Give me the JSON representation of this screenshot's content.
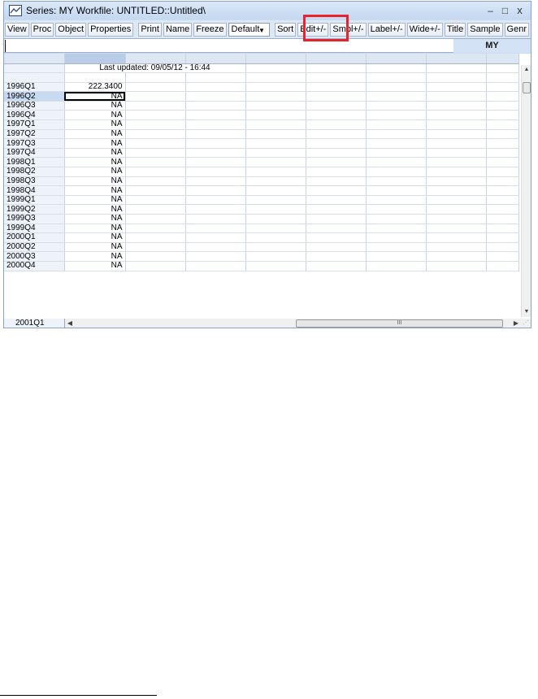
{
  "window": {
    "title": "Series: MY   Workfile: UNTITLED::Untitled\\",
    "minimize": "–",
    "maximize": "□",
    "close": "x"
  },
  "toolbar": {
    "view": "View",
    "proc": "Proc",
    "object": "Object",
    "properties": "Properties",
    "print": "Print",
    "name": "Name",
    "freeze": "Freeze",
    "display_mode": "Default",
    "sort": "Sort",
    "edit": "Edit+/-",
    "smpl": "Smpl+/-",
    "label": "Label+/-",
    "wide": "Wide+/-",
    "title": "Title",
    "sample": "Sample",
    "genr": "Genr"
  },
  "edit_bar": {
    "value": "",
    "series_name": "MY"
  },
  "grid": {
    "last_updated": "Last updated: 09/05/12 - 16:44",
    "rows": [
      {
        "label": "1996Q1",
        "value": "222.3400"
      },
      {
        "label": "1996Q2",
        "value": "NA"
      },
      {
        "label": "1996Q3",
        "value": "NA"
      },
      {
        "label": "1996Q4",
        "value": "NA"
      },
      {
        "label": "1997Q1",
        "value": "NA"
      },
      {
        "label": "1997Q2",
        "value": "NA"
      },
      {
        "label": "1997Q3",
        "value": "NA"
      },
      {
        "label": "1997Q4",
        "value": "NA"
      },
      {
        "label": "1998Q1",
        "value": "NA"
      },
      {
        "label": "1998Q2",
        "value": "NA"
      },
      {
        "label": "1998Q3",
        "value": "NA"
      },
      {
        "label": "1998Q4",
        "value": "NA"
      },
      {
        "label": "1999Q1",
        "value": "NA"
      },
      {
        "label": "1999Q2",
        "value": "NA"
      },
      {
        "label": "1999Q3",
        "value": "NA"
      },
      {
        "label": "1999Q4",
        "value": "NA"
      },
      {
        "label": "2000Q1",
        "value": "NA"
      },
      {
        "label": "2000Q2",
        "value": "NA"
      },
      {
        "label": "2000Q3",
        "value": "NA"
      },
      {
        "label": "2000Q4",
        "value": "NA"
      }
    ],
    "last_row_label": "2001Q1",
    "selected_row": "1996Q2"
  },
  "scrollbar": {
    "hthumb_grip": "III"
  },
  "colors": {
    "highlight": "#e8232b",
    "window_bg": "#c9dcf2",
    "selected_row": "#c8daf1"
  }
}
